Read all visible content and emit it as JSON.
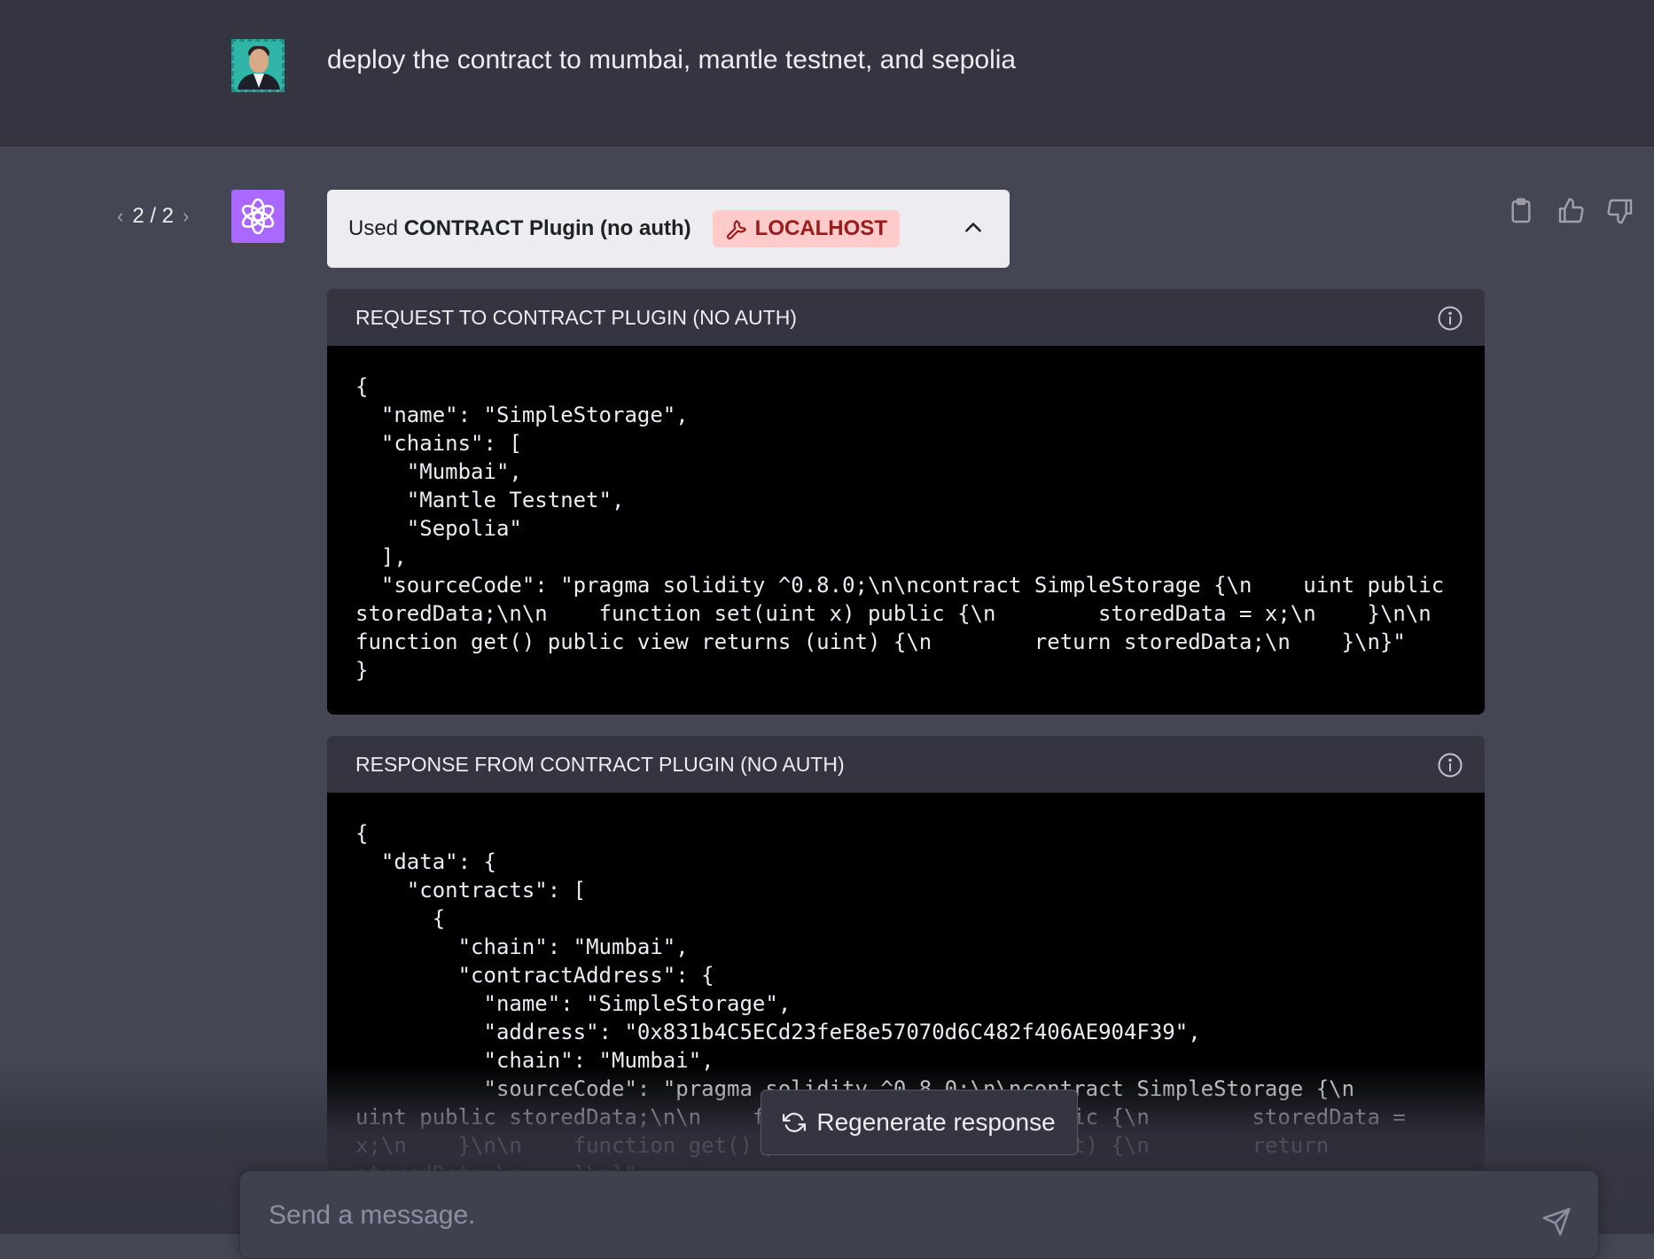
{
  "user_message": {
    "text": "deploy the contract to mumbai, mantle testnet, and sepolia"
  },
  "nav": {
    "prev_icon": "‹",
    "counter": "2 / 2",
    "next_icon": "›"
  },
  "plugin": {
    "used_prefix": "Used",
    "name": "CONTRACT Plugin (no auth)",
    "badge": "LOCALHOST"
  },
  "request": {
    "title": "REQUEST TO CONTRACT PLUGIN (NO AUTH)",
    "code": "{\n  \"name\": \"SimpleStorage\",\n  \"chains\": [\n    \"Mumbai\",\n    \"Mantle Testnet\",\n    \"Sepolia\"\n  ],\n  \"sourceCode\": \"pragma solidity ^0.8.0;\\n\\ncontract SimpleStorage {\\n    uint public storedData;\\n\\n    function set(uint x) public {\\n        storedData = x;\\n    }\\n\\n    function get() public view returns (uint) {\\n        return storedData;\\n    }\\n}\"\n}"
  },
  "response": {
    "title": "RESPONSE FROM CONTRACT PLUGIN (NO AUTH)",
    "code": "{\n  \"data\": {\n    \"contracts\": [\n      {\n        \"chain\": \"Mumbai\",\n        \"contractAddress\": {\n          \"name\": \"SimpleStorage\",\n          \"address\": \"0x831b4C5ECd23feE8e57070d6C482f406AE904F39\",\n          \"chain\": \"Mumbai\",\n          \"sourceCode\": \"pragma solidity ^0.8.0;\\n\\ncontract SimpleStorage {\\n    uint public storedData;\\n\\n    function set(uint x) public {\\n        storedData = x;\\n    }\\n\\n    function get() public view returns (uint) {\\n        return storedData;\\n    }\\n}\""
  },
  "regenerate": {
    "label": "Regenerate response"
  },
  "composer": {
    "placeholder": "Send a message."
  },
  "colors": {
    "accent": "#ab68ff",
    "badge_bg": "#fecaca",
    "badge_text": "#991b1b"
  }
}
